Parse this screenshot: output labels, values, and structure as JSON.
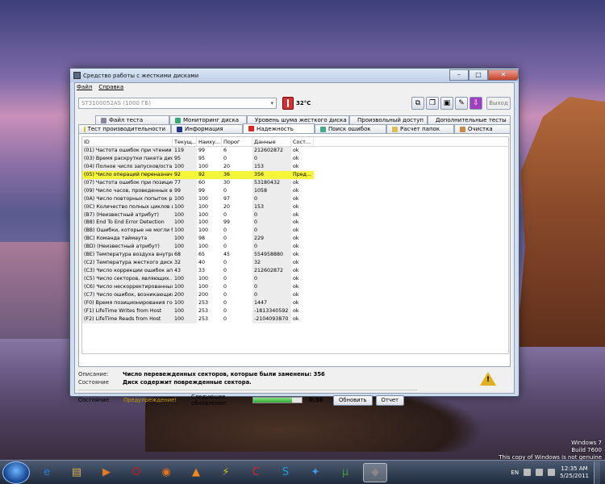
{
  "window": {
    "title": "Средство работы с жесткими дисками",
    "controls": {
      "minimize": "–",
      "maximize": "□",
      "close": "✕"
    }
  },
  "menu": [
    "Файл",
    "Справка"
  ],
  "drive": {
    "selected": "ST3100052AS (1000 ГБ)",
    "temperature": "32°C"
  },
  "toolbar": {
    "exit_label": "Выход"
  },
  "tabs_row1": [
    "Файл теста",
    "Мониторинг диска",
    "Уровень шума жесткого диска",
    "Произвольный доступ",
    "Дополнительные тесты"
  ],
  "tabs_row2": [
    "Тест производительности",
    "Информация",
    "Надежность",
    "Поиск ошибок",
    "Расчет папок",
    "Очистка"
  ],
  "active_tab": "Надежность",
  "grid": {
    "headers": [
      "ID",
      "Текущ...",
      "Наиху...",
      "Порог",
      "Данные",
      "Сост..."
    ],
    "rows": [
      [
        "(01) Частота ошибок при чтении д...",
        "119",
        "99",
        "6",
        "212602872",
        "ok"
      ],
      [
        "(03) Время раскрутки пакета дис...",
        "95",
        "95",
        "0",
        "0",
        "ok"
      ],
      [
        "(04) Полное число запусков/оста...",
        "100",
        "100",
        "20",
        "153",
        "ok"
      ],
      [
        "(05) Число операций переназначе...",
        "92",
        "92",
        "36",
        "356",
        "Пред..."
      ],
      [
        "(07) Частота ошибок при позицио...",
        "77",
        "60",
        "30",
        "53180432",
        "ok"
      ],
      [
        "(09) Число часов, проведенных во...",
        "99",
        "99",
        "0",
        "1058",
        "ok"
      ],
      [
        "(0A) Число повторных попыток ра...",
        "100",
        "100",
        "97",
        "0",
        "ok"
      ],
      [
        "(0C) Количество полных циклов в...",
        "100",
        "100",
        "20",
        "153",
        "ok"
      ],
      [
        "(B7) (Неизвестный атрибут)",
        "100",
        "100",
        "0",
        "0",
        "ok"
      ],
      [
        "(B8) End To End Error Detection",
        "100",
        "100",
        "99",
        "0",
        "ok"
      ],
      [
        "(BB) Ошибки, которые не могли б...",
        "100",
        "100",
        "0",
        "0",
        "ok"
      ],
      [
        "(BC) Команда таймаута",
        "100",
        "98",
        "0",
        "229",
        "ok"
      ],
      [
        "(BD) (Неизвестный атрибут)",
        "100",
        "100",
        "0",
        "0",
        "ok"
      ],
      [
        "(BE) Температура воздуха внутри ...",
        "68",
        "65",
        "45",
        "554958880",
        "ok"
      ],
      [
        "(C2) Температура жесткого диска",
        "32",
        "40",
        "0",
        "32",
        "ok"
      ],
      [
        "(C3) Число коррекции ошибок апп...",
        "43",
        "33",
        "0",
        "212602872",
        "ok"
      ],
      [
        "(C5) Число секторов, являющих...",
        "100",
        "100",
        "0",
        "0",
        "ok"
      ],
      [
        "(C6) Число нескорректированных...",
        "100",
        "100",
        "0",
        "0",
        "ok"
      ],
      [
        "(C7) Число ошибок, возникающих...",
        "200",
        "200",
        "0",
        "0",
        "ok"
      ],
      [
        "(F0) Время позиционирования гол...",
        "100",
        "253",
        "0",
        "1447",
        "ok"
      ],
      [
        "(F1) LifeTime Writes from Host",
        "100",
        "253",
        "0",
        "-1813340592",
        "ok"
      ],
      [
        "(F2) LifeTime Reads from Host",
        "100",
        "253",
        "0",
        "-2104093870",
        "ok"
      ]
    ],
    "highlighted_row": 3
  },
  "details": {
    "description_label": "Описание:",
    "description": "Число перевежденных секторов, которые были заменены: 356",
    "state_label": "Состояние",
    "state": "Диск содержит поврежденные сектора."
  },
  "status": {
    "label": "Состояние",
    "value": "Предупреждение!",
    "next_update_label": "Следующее обновление:",
    "progress": 0.8,
    "time": "0:36",
    "refresh_button": "Обновить",
    "report_button": "Отчет"
  },
  "taskbar": {
    "apps": [
      "ie-icon",
      "explorer-icon",
      "media-player-icon",
      "opera-icon",
      "firefox-icon",
      "vlc-icon",
      "winamp-icon",
      "ccleaner-icon",
      "skype-icon",
      "safari-icon",
      "utorrent-icon",
      "hdd-tool-icon"
    ],
    "language": "EN",
    "time": "12:35 AM",
    "date": "5/25/2011"
  },
  "watermark": [
    "Windows 7",
    "Build 7600",
    "This copy of Windows is not genuine"
  ]
}
